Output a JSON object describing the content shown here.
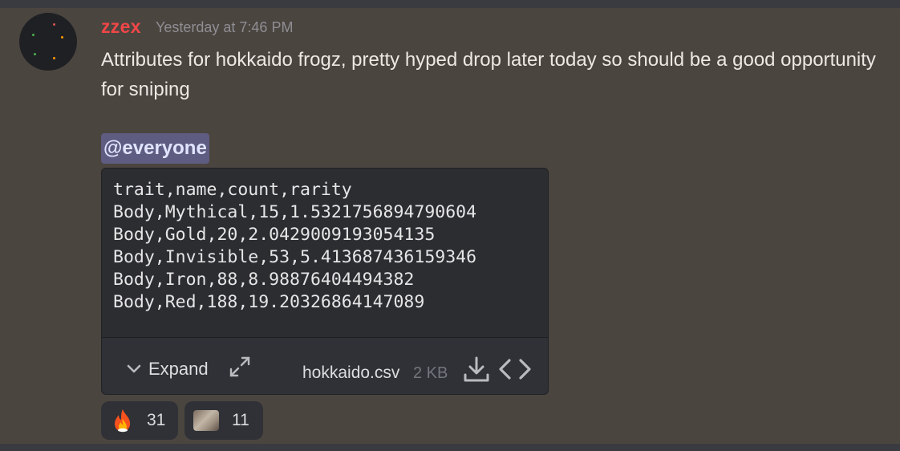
{
  "message": {
    "username": "zzex",
    "username_color": "#f04747",
    "timestamp": "Yesterday at 7:46 PM",
    "text": "Attributes for hokkaido frogz, pretty hyped drop later today so should be a good opportunity for sniping",
    "mention": "@everyone"
  },
  "attachment": {
    "lines": [
      "trait,name,count,rarity",
      "Body,Mythical,15,1.5321756894790604",
      "Body,Gold,20,2.0429009193054135",
      "Body,Invisible,53,5.413687436159346",
      "Body,Iron,88,8.98876404494382",
      "Body,Red,188,19.20326864147089"
    ],
    "expand_label": "Expand",
    "expand_icon": "chevron-down-icon",
    "fullscreen_icon": "expand-arrows-icon",
    "filename": "hokkaido.csv",
    "filesize": "2 KB",
    "download_icon": "download-icon",
    "code_icon": "code-icon"
  },
  "reactions": [
    {
      "emoji": "fire-emoji",
      "count": "31"
    },
    {
      "emoji": "custom-image-emoji",
      "count": "11"
    }
  ]
}
